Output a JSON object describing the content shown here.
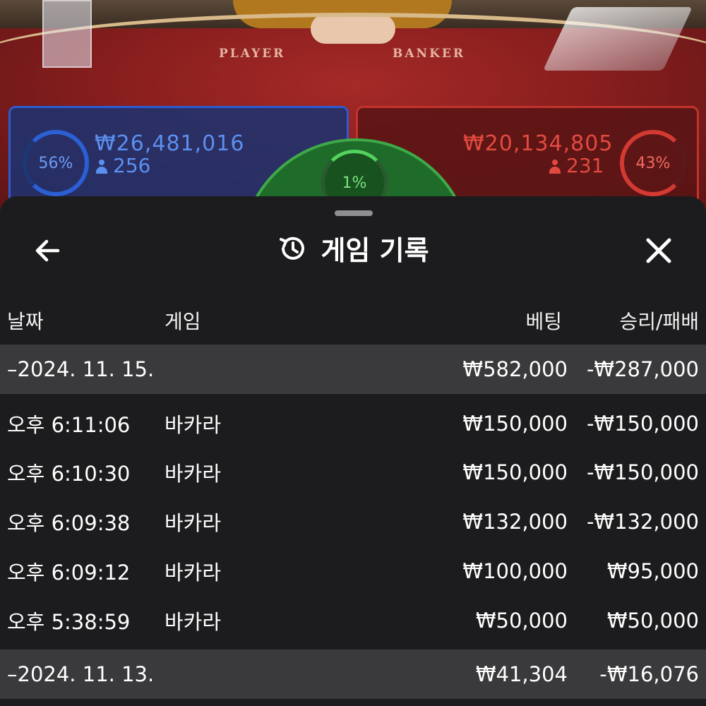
{
  "table": {
    "player_label": "PLAYER",
    "banker_label": "BANKER",
    "player": {
      "percent": "56%",
      "amount": "₩26,481,016",
      "count": "256"
    },
    "banker": {
      "percent": "43%",
      "amount": "₩20,134,805",
      "count": "231"
    },
    "tie": {
      "percent": "1%"
    },
    "colors": {
      "player": "#2d5bd0",
      "banker": "#c2342c",
      "tie": "#3ea948"
    }
  },
  "panel": {
    "title": "게임 기록",
    "icons": {
      "back": "arrow-left-icon",
      "history": "history-icon",
      "close": "close-icon"
    },
    "columns": {
      "date": "날짜",
      "game": "게임",
      "bet": "베팅",
      "result": "승리/패배"
    },
    "groups": [
      {
        "date": "–2024. 11. 15.",
        "bet": "₩582,000",
        "result": "-₩287,000",
        "rows": [
          {
            "time": "오후 6:11:06",
            "game": "바카라",
            "bet": "₩150,000",
            "result": "-₩150,000"
          },
          {
            "time": "오후 6:10:30",
            "game": "바카라",
            "bet": "₩150,000",
            "result": "-₩150,000"
          },
          {
            "time": "오후 6:09:38",
            "game": "바카라",
            "bet": "₩132,000",
            "result": "-₩132,000"
          },
          {
            "time": "오후 6:09:12",
            "game": "바카라",
            "bet": "₩100,000",
            "result": "₩95,000"
          },
          {
            "time": "오후 5:38:59",
            "game": "바카라",
            "bet": "₩50,000",
            "result": "₩50,000"
          }
        ]
      },
      {
        "date": "–2024. 11. 13.",
        "bet": "₩41,304",
        "result": "-₩16,076",
        "rows": []
      }
    ]
  }
}
